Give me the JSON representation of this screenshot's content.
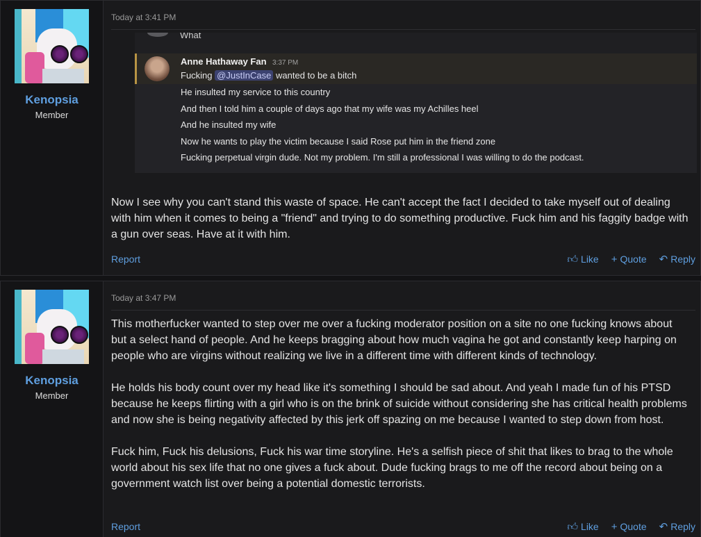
{
  "posts": [
    {
      "user": {
        "name": "Kenopsia",
        "title": "Member"
      },
      "timestamp": "Today at 3:41 PM",
      "embed": {
        "prev_text": "What",
        "reply_name": "Anne Hathaway Fan",
        "reply_time": "3:37 PM",
        "first_line_prefix": "Fucking",
        "mention": "@JustInCase",
        "first_line_suffix": "wanted to be a bitch",
        "lines": [
          "He insulted my service to this country",
          "And then I told him a couple of days ago that my wife was my Achilles heel",
          "And he insulted my wife",
          "Now he wants to play the victim because I said Rose put him in the friend zone",
          "Fucking perpetual virgin dude. Not my problem. I'm still a professional I was willing to do the podcast."
        ]
      },
      "body": [
        "Now I see why you can't stand this waste of space. He can't accept the fact I decided to take myself out of dealing with him when it comes to being a \"friend\" and trying to do something productive. Fuck him and his faggity badge with a gun over seas. Have at it with him."
      ],
      "actions": {
        "report": "Report",
        "like": "Like",
        "quote": "Quote",
        "reply": "Reply"
      }
    },
    {
      "user": {
        "name": "Kenopsia",
        "title": "Member"
      },
      "timestamp": "Today at 3:47 PM",
      "body": [
        "This motherfucker wanted to step over me over a fucking moderator position on a site no one fucking knows about but a select hand of people. And he keeps bragging about how much vagina he got and constantly keep harping on people who are virgins without realizing we live in a different time with different kinds of technology.",
        "He holds his body count over my head like it's something I should be sad about. And yeah I made fun of his PTSD because he keeps flirting with a girl who is on the brink of suicide without considering she has critical health problems and now she is being negativity affected by this jerk off spazing on me because I wanted to step down from host.",
        "Fuck him, Fuck his delusions, Fuck his war time storyline. He's a selfish piece of shit that likes to brag to the whole world about his sex life that no one gives a fuck about. Dude fucking brags to me off the record about being on a government watch list over being a potential domestic terrorists."
      ],
      "actions": {
        "report": "Report",
        "like": "Like",
        "quote": "Quote",
        "reply": "Reply"
      }
    }
  ]
}
